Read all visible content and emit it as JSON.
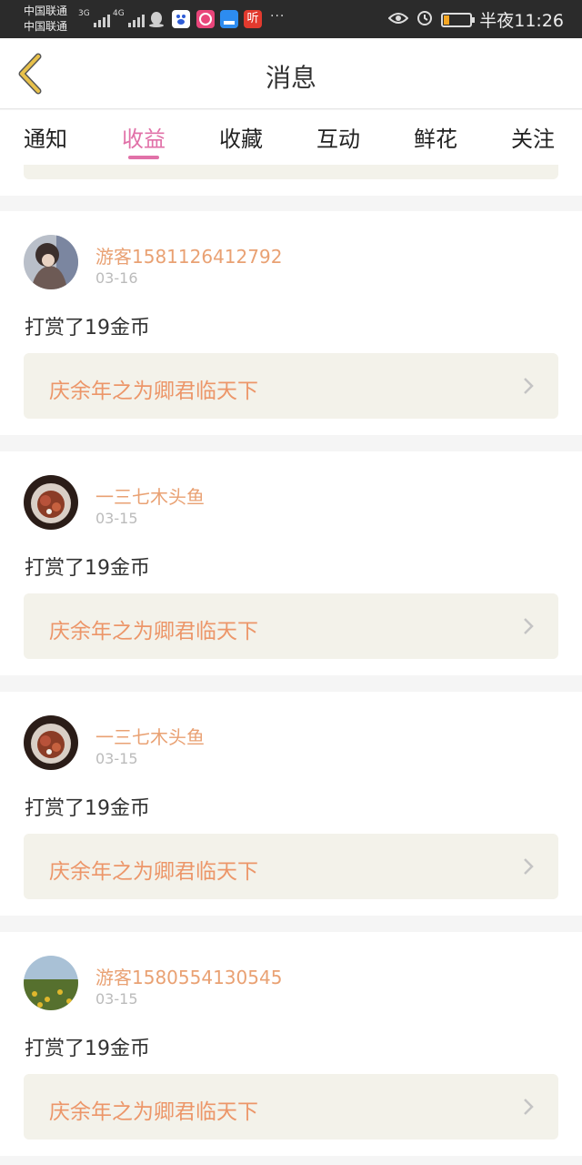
{
  "status": {
    "carrier1": "中国联通",
    "carrier2": "中国联通",
    "net1": "3G",
    "net2": "4G",
    "more": "···",
    "time": "半夜11:26",
    "battery_level": 0.2,
    "icons": [
      "qq-icon",
      "baidu-icon",
      "weibo-icon",
      "message-icon",
      "ting-icon",
      "eye-icon",
      "alarm-icon",
      "battery-icon"
    ]
  },
  "header": {
    "title": "消息"
  },
  "tabs": [
    "通知",
    "收益",
    "收藏",
    "互动",
    "鲜花",
    "关注"
  ],
  "active_tab": "收益",
  "cards": [
    {
      "user": "游客1581126412792",
      "date": "03-16",
      "text": "打赏了19金币",
      "book": "庆余年之为卿君临天下"
    },
    {
      "user": "一三七木头鱼",
      "date": "03-15",
      "text": "打赏了19金币",
      "book": "庆余年之为卿君临天下"
    },
    {
      "user": "一三七木头鱼",
      "date": "03-15",
      "text": "打赏了19金币",
      "book": "庆余年之为卿君临天下"
    },
    {
      "user": "游客1580554130545",
      "date": "03-15",
      "text": "打赏了19金币",
      "book": "庆余年之为卿君临天下"
    }
  ],
  "colors": {
    "accent": "#e171a8",
    "username": "#e9a173",
    "book_title": "#ec9669",
    "back_arrow": "#e8c14a"
  }
}
